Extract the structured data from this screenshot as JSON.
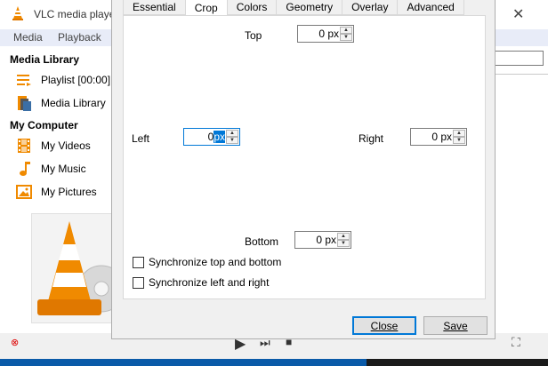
{
  "window": {
    "title": "VLC media playe",
    "menus": [
      "Media",
      "Playback"
    ]
  },
  "sidebar": {
    "media_library_header": "Media Library",
    "media_library_items": [
      {
        "label": "Playlist [00:00]",
        "icon": "playlist-icon"
      },
      {
        "label": "Media Library",
        "icon": "media-library-icon"
      }
    ],
    "my_computer_header": "My Computer",
    "my_computer_items": [
      {
        "label": "My Videos",
        "icon": "film-icon"
      },
      {
        "label": "My Music",
        "icon": "music-note-icon"
      },
      {
        "label": "My Pictures",
        "icon": "picture-icon"
      }
    ]
  },
  "dialog": {
    "tabs": [
      "Essential",
      "Crop",
      "Colors",
      "Geometry",
      "Overlay",
      "Advanced"
    ],
    "active_tab": "Crop",
    "crop": {
      "top": {
        "label": "Top",
        "value": "0 px"
      },
      "left": {
        "label": "Left",
        "value_number": "0",
        "value_unit": "px"
      },
      "right": {
        "label": "Right",
        "value": "0 px"
      },
      "bottom": {
        "label": "Bottom",
        "value": "0 px"
      }
    },
    "sync_top_bottom": {
      "label": "Synchronize top and bottom",
      "checked": false
    },
    "sync_left_right": {
      "label": "Synchronize left and right",
      "checked": false
    },
    "close_label": "Close",
    "save_label": "Save"
  },
  "colors": {
    "accent": "#0078d7",
    "vlc_orange": "#f08a00"
  }
}
